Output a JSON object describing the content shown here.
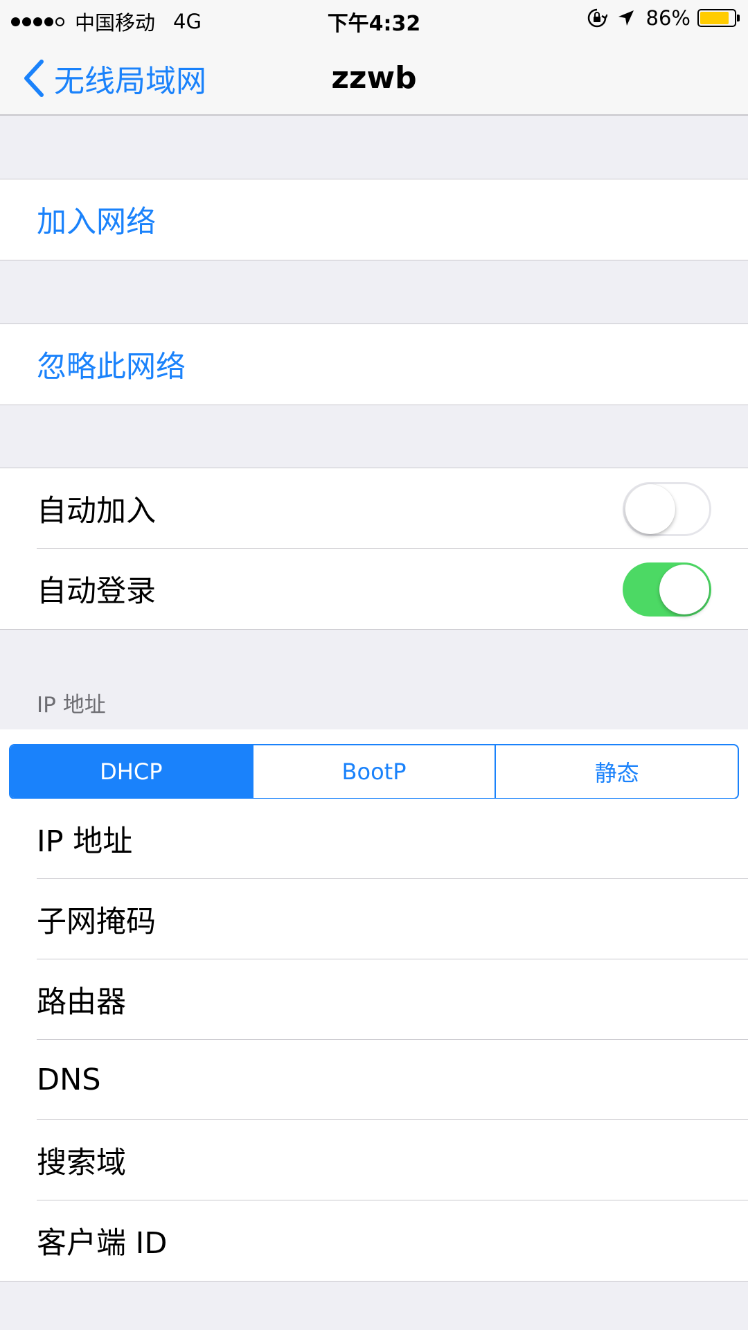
{
  "status_bar": {
    "carrier": "中国移动",
    "network": "4G",
    "time": "下午4:32",
    "battery_percent": "86%",
    "battery_level": 0.86
  },
  "nav": {
    "back_label": "无线局域网",
    "title": "zzwb"
  },
  "actions": {
    "join_network": "加入网络",
    "forget_network": "忽略此网络"
  },
  "toggles": {
    "auto_join": {
      "label": "自动加入",
      "on": false
    },
    "auto_login": {
      "label": "自动登录",
      "on": true
    }
  },
  "ip_section": {
    "header": "IP 地址",
    "segments": [
      "DHCP",
      "BootP",
      "静态"
    ],
    "selected_segment": "DHCP",
    "rows": [
      "IP 地址",
      "子网掩码",
      "路由器",
      "DNS",
      "搜索域",
      "客户端 ID"
    ]
  },
  "colors": {
    "accent": "#1a82fb",
    "switch_on": "#4cd964",
    "battery": "#ffcc00"
  }
}
